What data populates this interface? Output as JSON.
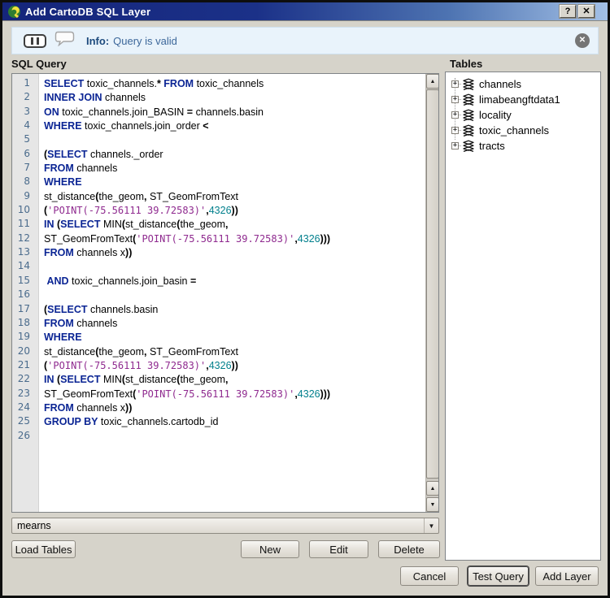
{
  "window": {
    "title": "Add CartoDB SQL Layer",
    "help_label": "?",
    "close_label": "✕"
  },
  "infobar": {
    "prefix": "Info:",
    "message": "Query is valid"
  },
  "left": {
    "heading": "SQL Query"
  },
  "connection_combo": {
    "value": "mearns"
  },
  "buttons": {
    "load_tables": "Load Tables",
    "new": "New",
    "edit": "Edit",
    "delete": "Delete"
  },
  "tables": {
    "heading": "Tables",
    "items": [
      "channels",
      "limabeangftdata1",
      "locality",
      "toxic_channels",
      "tracts"
    ]
  },
  "footer": {
    "cancel": "Cancel",
    "test_query": "Test Query",
    "add_layer": "Add Layer"
  },
  "colors": {
    "titlebar_left": "#15257B",
    "titlebar_right": "#A6CAF0",
    "panel_bg": "#D6D3CA",
    "info_bg": "#E9F3FB",
    "info_text": "#3C679A",
    "keyword": "#0B2594",
    "string": "#8F2A8F",
    "number": "#007F8C",
    "line_number": "#4A6B8C"
  },
  "editor": {
    "lines": [
      [
        [
          "k",
          "SELECT"
        ],
        [
          "i",
          " toxic_channels."
        ],
        [
          "o",
          "*"
        ],
        [
          "k",
          " FROM"
        ],
        [
          "i",
          " toxic_channels"
        ]
      ],
      [
        [
          "k",
          "INNER JOIN"
        ],
        [
          "i",
          " channels"
        ]
      ],
      [
        [
          "k",
          "ON"
        ],
        [
          "i",
          " toxic_channels.join_BASIN "
        ],
        [
          "o",
          "="
        ],
        [
          "i",
          " channels.basin"
        ]
      ],
      [
        [
          "k",
          "WHERE"
        ],
        [
          "i",
          " toxic_channels.join_order "
        ],
        [
          "o",
          "<"
        ]
      ],
      [],
      [
        [
          "o",
          "("
        ],
        [
          "k",
          "SELECT"
        ],
        [
          "i",
          " channels._order"
        ]
      ],
      [
        [
          "k",
          "FROM"
        ],
        [
          "i",
          " channels"
        ]
      ],
      [
        [
          "k",
          "WHERE"
        ]
      ],
      [
        [
          "i",
          "st_distance"
        ],
        [
          "o",
          "("
        ],
        [
          "i",
          "the_geom"
        ],
        [
          "o",
          ","
        ],
        [
          "i",
          " ST_GeomFromText"
        ]
      ],
      [
        [
          "o",
          "("
        ],
        [
          "s",
          "'POINT(-75.56111 39.72583)'"
        ],
        [
          "o",
          ","
        ],
        [
          "n",
          "4326"
        ],
        [
          "o",
          "))"
        ]
      ],
      [
        [
          "k",
          "IN"
        ],
        [
          "i",
          " "
        ],
        [
          "o",
          "("
        ],
        [
          "k",
          "SELECT"
        ],
        [
          "i",
          " MIN"
        ],
        [
          "o",
          "("
        ],
        [
          "i",
          "st_distance"
        ],
        [
          "o",
          "("
        ],
        [
          "i",
          "the_geom"
        ],
        [
          "o",
          ","
        ]
      ],
      [
        [
          "i",
          "ST_GeomFromText"
        ],
        [
          "o",
          "("
        ],
        [
          "s",
          "'POINT(-75.56111 39.72583)'"
        ],
        [
          "o",
          ","
        ],
        [
          "n",
          "4326"
        ],
        [
          "o",
          ")))"
        ]
      ],
      [
        [
          "k",
          "FROM"
        ],
        [
          "i",
          " channels x"
        ],
        [
          "o",
          "))"
        ]
      ],
      [],
      [
        [
          "i",
          " "
        ],
        [
          "k",
          "AND"
        ],
        [
          "i",
          " toxic_channels.join_basin "
        ],
        [
          "o",
          "="
        ]
      ],
      [],
      [
        [
          "o",
          "("
        ],
        [
          "k",
          "SELECT"
        ],
        [
          "i",
          " channels.basin"
        ]
      ],
      [
        [
          "k",
          "FROM"
        ],
        [
          "i",
          " channels"
        ]
      ],
      [
        [
          "k",
          "WHERE"
        ]
      ],
      [
        [
          "i",
          "st_distance"
        ],
        [
          "o",
          "("
        ],
        [
          "i",
          "the_geom"
        ],
        [
          "o",
          ","
        ],
        [
          "i",
          " ST_GeomFromText"
        ]
      ],
      [
        [
          "o",
          "("
        ],
        [
          "s",
          "'POINT(-75.56111 39.72583)'"
        ],
        [
          "o",
          ","
        ],
        [
          "n",
          "4326"
        ],
        [
          "o",
          "))"
        ]
      ],
      [
        [
          "k",
          "IN"
        ],
        [
          "i",
          " "
        ],
        [
          "o",
          "("
        ],
        [
          "k",
          "SELECT"
        ],
        [
          "i",
          " MIN"
        ],
        [
          "o",
          "("
        ],
        [
          "i",
          "st_distance"
        ],
        [
          "o",
          "("
        ],
        [
          "i",
          "the_geom"
        ],
        [
          "o",
          ","
        ]
      ],
      [
        [
          "i",
          "ST_GeomFromText"
        ],
        [
          "o",
          "("
        ],
        [
          "s",
          "'POINT(-75.56111 39.72583)'"
        ],
        [
          "o",
          ","
        ],
        [
          "n",
          "4326"
        ],
        [
          "o",
          ")))"
        ]
      ],
      [
        [
          "k",
          "FROM"
        ],
        [
          "i",
          " channels x"
        ],
        [
          "o",
          "))"
        ]
      ],
      [
        [
          "k",
          "GROUP BY"
        ],
        [
          "i",
          " toxic_channels.cartodb_id"
        ]
      ],
      []
    ]
  }
}
